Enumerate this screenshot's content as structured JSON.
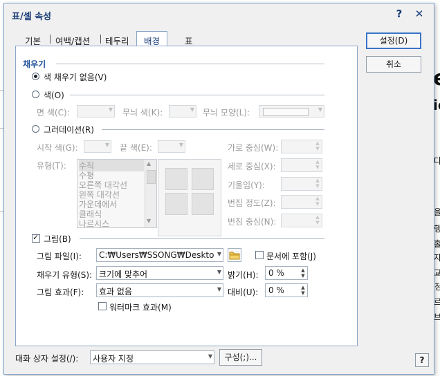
{
  "window": {
    "title": "표/셀 속성",
    "help_symbol": "?",
    "close_symbol": "✕"
  },
  "tabs": [
    {
      "label": "기본"
    },
    {
      "label": "여백/캡션"
    },
    {
      "label": "테두리"
    },
    {
      "label": "배경"
    },
    {
      "label": "표"
    }
  ],
  "fill": {
    "section_label": "채우기",
    "no_fill_label": "색 채우기 없음(V)",
    "color_label": "색(O)",
    "face_color_label": "면 색(C):",
    "pattern_color_label": "무늬 색(K):",
    "pattern_shape_label": "무늬 모양(L):",
    "gradient_label": "그러데이션(R)",
    "start_color_label": "시작 색(G):",
    "end_color_label": "끝 색(E):",
    "type_label": "유형(T):",
    "gradient_types": [
      "수직",
      "수평",
      "오른쪽 대각선",
      "왼쪽 대각선",
      "가운데에서",
      "클래식",
      "나르시스"
    ],
    "h_center_label": "가로 중심(W):",
    "v_center_label": "세로 중심(X):",
    "slope_label": "기울임(Y):",
    "spread_label": "번짐 정도(Z):",
    "spread_center_label": "번짐 중심(N):",
    "picture_label": "그림(B)",
    "picture_file_label": "그림 파일(I):",
    "picture_file_value": "C:₩Users₩SSONG₩Desktop",
    "embed_label": "문서에 포함(J)",
    "fill_type_label": "채우기 유형(S):",
    "fill_type_value": "크기에 맞추어",
    "brightness_label": "밝기(H):",
    "brightness_value": "0 %",
    "effect_label": "그림 효과(F):",
    "effect_value": "효과 없음",
    "contrast_label": "대비(U):",
    "contrast_value": "0 %",
    "watermark_label": "워터마크 효과(M)"
  },
  "state": {
    "no_fill_selected": true,
    "picture_checked": true,
    "embed_checked": false,
    "watermark_checked": false
  },
  "buttons": {
    "ok": "설정(D)",
    "cancel": "취소",
    "config": "구성(;)...",
    "help": "?"
  },
  "footer": {
    "dialog_setting_label": "대화 상자 설정(/):",
    "dialog_setting_value": "사용자 지정"
  },
  "background_doc": {
    "glyphs": [
      "e",
      "ie",
      "다",
      "을",
      "행",
      "홀",
      "자",
      "교",
      "정",
      "르",
      "브"
    ]
  }
}
